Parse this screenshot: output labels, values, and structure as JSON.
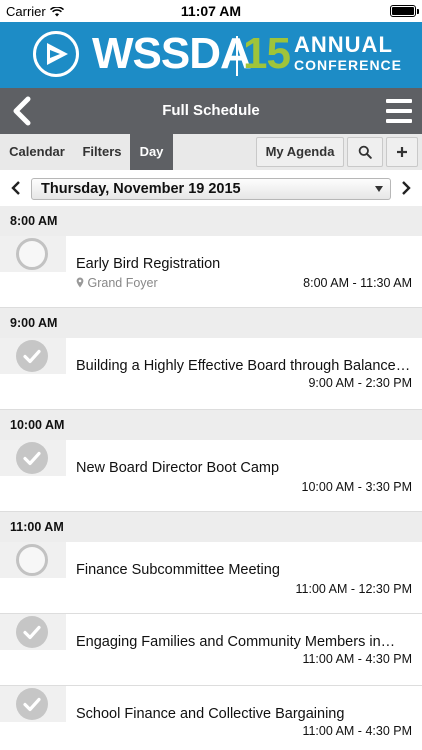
{
  "status": {
    "carrier": "Carrier",
    "time": "11:07 AM"
  },
  "banner": {
    "brand": "WSSDA",
    "year": "15",
    "annual": "ANNUAL",
    "conference": "CONFERENCE"
  },
  "nav": {
    "title": "Full Schedule",
    "back_icon": "chevron-left-icon",
    "menu_icon": "hamburger-icon"
  },
  "toolbar": {
    "calendar": "Calendar",
    "filters": "Filters",
    "day": "Day",
    "my_agenda": "My Agenda",
    "search_icon": "search-icon",
    "add_icon": "plus-icon"
  },
  "date": {
    "selected": "Thursday, November 19 2015"
  },
  "groups": [
    {
      "time": "8:00 AM",
      "sessions": [
        {
          "name": "Early Bird Registration",
          "location": "Grand Foyer",
          "hours": "8:00 AM - 11:30 AM",
          "added": false
        }
      ]
    },
    {
      "time": "9:00 AM",
      "sessions": [
        {
          "name": "Building a Highly Effective Board through Balance…",
          "location": "",
          "hours": "9:00 AM - 2:30 PM",
          "added": true
        }
      ]
    },
    {
      "time": "10:00 AM",
      "sessions": [
        {
          "name": "New Board Director Boot Camp",
          "location": "",
          "hours": "10:00 AM - 3:30 PM",
          "added": true
        }
      ]
    },
    {
      "time": "11:00 AM",
      "sessions": [
        {
          "name": "Finance Subcommittee Meeting",
          "location": "",
          "hours": "11:00 AM - 12:30 PM",
          "added": false
        },
        {
          "name": "Engaging Families and Community Members in…",
          "location": "",
          "hours": "11:00 AM - 4:30 PM",
          "added": true
        },
        {
          "name": "School Finance and Collective Bargaining",
          "location": "",
          "hours": "11:00 AM - 4:30 PM",
          "added": true
        }
      ]
    }
  ],
  "colors": {
    "brand_blue": "#1d8cc6",
    "brand_green": "#9fc43a",
    "nav_gray": "#5e6064"
  }
}
